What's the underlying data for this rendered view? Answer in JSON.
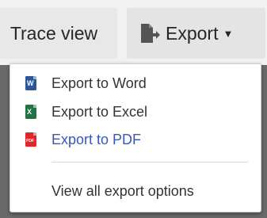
{
  "toolbar": {
    "trace_view_label": "Trace view",
    "export_label": "Export",
    "export_icon": "document-arrow-icon",
    "caret_icon": "caret-down-icon"
  },
  "export_menu": {
    "items": [
      {
        "label": "Export to Word",
        "icon": "word-file-icon",
        "icon_color": "#2b579a",
        "icon_letter": "W"
      },
      {
        "label": "Export to Excel",
        "icon": "excel-file-icon",
        "icon_color": "#217346",
        "icon_letter": "X"
      },
      {
        "label": "Export to PDF",
        "icon": "pdf-file-icon",
        "icon_color": "#e0262a",
        "icon_letter": "PDF",
        "highlighted": true,
        "text_color": "#3a57b8"
      }
    ],
    "view_all_label": "View all export options"
  }
}
